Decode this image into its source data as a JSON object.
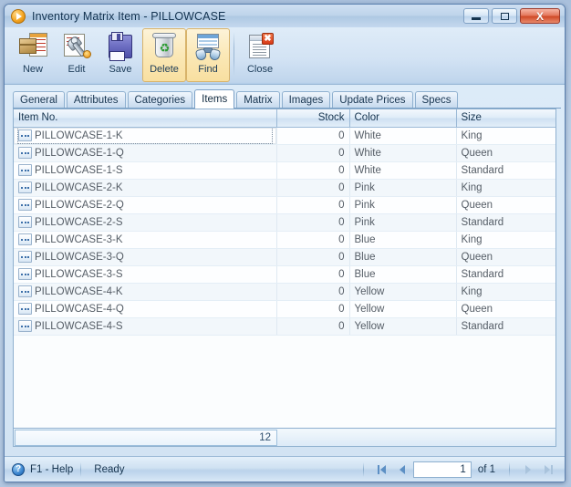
{
  "window": {
    "title": "Inventory Matrix Item - PILLOWCASE",
    "icon": "play-circle-icon",
    "buttons": {
      "minimize": "minimize-icon",
      "maximize": "maximize-icon",
      "close": "X"
    }
  },
  "toolbar": {
    "items": [
      {
        "label": "New",
        "icon": "new-item-icon",
        "highlighted": false
      },
      {
        "label": "Edit",
        "icon": "wrench-edit-icon",
        "highlighted": false
      },
      {
        "label": "Save",
        "icon": "floppy-save-icon",
        "highlighted": false
      },
      {
        "label": "Delete",
        "icon": "recycle-bin-icon",
        "highlighted": true
      },
      {
        "label": "Find",
        "icon": "binoculars-icon",
        "highlighted": true
      },
      {
        "label": "Close",
        "icon": "close-document-icon",
        "highlighted": false
      }
    ]
  },
  "tabs": [
    {
      "label": "General",
      "active": false
    },
    {
      "label": "Attributes",
      "active": false
    },
    {
      "label": "Categories",
      "active": false
    },
    {
      "label": "Items",
      "active": true
    },
    {
      "label": "Matrix",
      "active": false
    },
    {
      "label": "Images",
      "active": false
    },
    {
      "label": "Update Prices",
      "active": false
    },
    {
      "label": "Specs",
      "active": false
    }
  ],
  "grid": {
    "columns": [
      {
        "label": "Item No.",
        "align": "left"
      },
      {
        "label": "Stock",
        "align": "right"
      },
      {
        "label": "Color",
        "align": "left"
      },
      {
        "label": "Size",
        "align": "left"
      }
    ],
    "rows": [
      {
        "item_no": "PILLOWCASE-1-K",
        "stock": "0",
        "color": "White",
        "size": "King",
        "selected": true
      },
      {
        "item_no": "PILLOWCASE-1-Q",
        "stock": "0",
        "color": "White",
        "size": "Queen",
        "selected": false
      },
      {
        "item_no": "PILLOWCASE-1-S",
        "stock": "0",
        "color": "White",
        "size": "Standard",
        "selected": false
      },
      {
        "item_no": "PILLOWCASE-2-K",
        "stock": "0",
        "color": "Pink",
        "size": "King",
        "selected": false
      },
      {
        "item_no": "PILLOWCASE-2-Q",
        "stock": "0",
        "color": "Pink",
        "size": "Queen",
        "selected": false
      },
      {
        "item_no": "PILLOWCASE-2-S",
        "stock": "0",
        "color": "Pink",
        "size": "Standard",
        "selected": false
      },
      {
        "item_no": "PILLOWCASE-3-K",
        "stock": "0",
        "color": "Blue",
        "size": "King",
        "selected": false
      },
      {
        "item_no": "PILLOWCASE-3-Q",
        "stock": "0",
        "color": "Blue",
        "size": "Queen",
        "selected": false
      },
      {
        "item_no": "PILLOWCASE-3-S",
        "stock": "0",
        "color": "Blue",
        "size": "Standard",
        "selected": false
      },
      {
        "item_no": "PILLOWCASE-4-K",
        "stock": "0",
        "color": "Yellow",
        "size": "King",
        "selected": false
      },
      {
        "item_no": "PILLOWCASE-4-Q",
        "stock": "0",
        "color": "Yellow",
        "size": "Queen",
        "selected": false
      },
      {
        "item_no": "PILLOWCASE-4-S",
        "stock": "0",
        "color": "Yellow",
        "size": "Standard",
        "selected": false
      }
    ],
    "footer_total": "12",
    "row_button_icon": "ellipsis-button-icon"
  },
  "statusbar": {
    "help_icon": "help-question-icon",
    "help_label": "F1 - Help",
    "status": "Ready",
    "nav": {
      "first_icon": "first-page-icon",
      "prev_icon": "previous-page-icon",
      "next_icon": "next-page-icon",
      "last_icon": "last-page-icon",
      "page_value": "1",
      "page_of_label": "of 1"
    }
  },
  "colors": {
    "accent": "#3c86d0",
    "title_text": "#11314f",
    "highlight": "#fbe8b6",
    "close_button": "#d93a16"
  }
}
